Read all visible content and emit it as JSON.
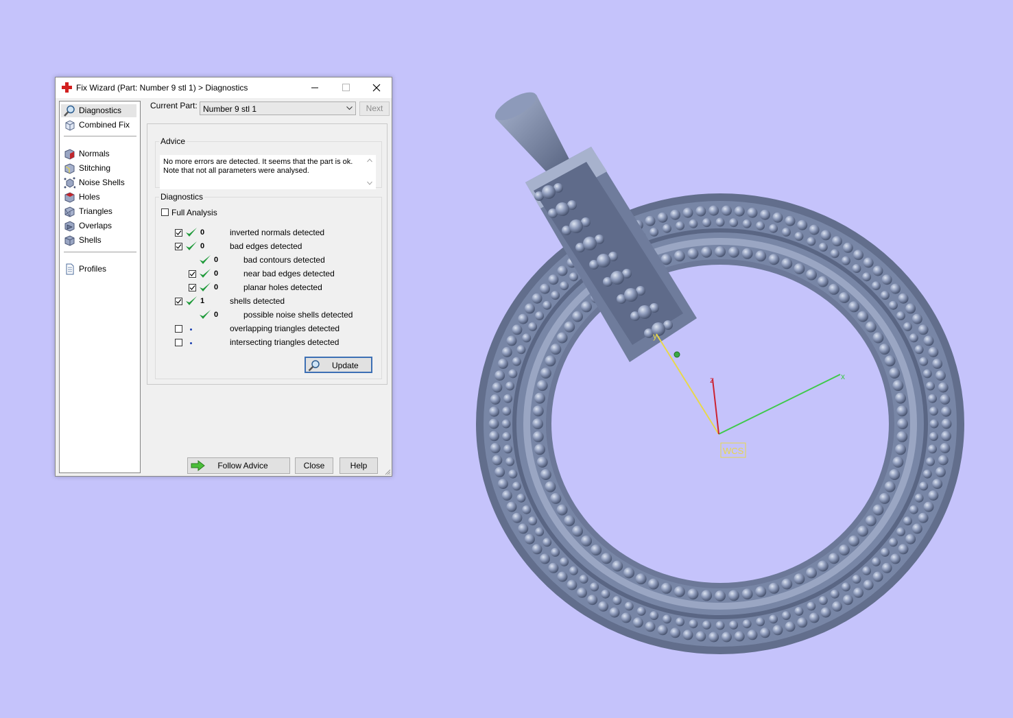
{
  "window": {
    "title": "Fix Wizard (Part: Number 9 stl 1) > Diagnostics",
    "controls": {
      "minimize": "minimize-icon",
      "maximize": "maximize-icon",
      "close": "close-icon"
    }
  },
  "sidebar": {
    "items": [
      {
        "label": "Diagnostics",
        "icon": "magnifier-icon",
        "selected": true
      },
      {
        "label": "Combined Fix",
        "icon": "cube-icon"
      },
      {
        "label": "Normals",
        "icon": "normals-cube-icon"
      },
      {
        "label": "Stitching",
        "icon": "stitching-cube-icon"
      },
      {
        "label": "Noise Shells",
        "icon": "noise-shells-icon"
      },
      {
        "label": "Holes",
        "icon": "holes-cube-icon"
      },
      {
        "label": "Triangles",
        "icon": "triangles-cube-icon"
      },
      {
        "label": "Overlaps",
        "icon": "overlaps-cube-icon"
      },
      {
        "label": "Shells",
        "icon": "shells-cube-icon"
      },
      {
        "label": "Profiles",
        "icon": "document-icon"
      }
    ]
  },
  "current_part": {
    "label": "Current Part:",
    "value": "Number 9 stl 1",
    "next_label": "Next"
  },
  "advice": {
    "legend": "Advice",
    "text": "No more errors are detected. It seems that the part is ok. Note that not all parameters were analysed."
  },
  "diagnostics": {
    "legend": "Diagnostics",
    "full_analysis_label": "Full Analysis",
    "full_analysis_checked": false,
    "rows": [
      {
        "checkbox": true,
        "checked": true,
        "status": "ok",
        "count": "0",
        "text": "inverted normals detected",
        "indent": 0
      },
      {
        "checkbox": true,
        "checked": true,
        "status": "ok",
        "count": "0",
        "text": "bad edges detected",
        "indent": 0
      },
      {
        "checkbox": false,
        "checked": false,
        "status": "ok",
        "count": "0",
        "text": "bad contours detected",
        "indent": 1
      },
      {
        "checkbox": true,
        "checked": true,
        "status": "ok",
        "count": "0",
        "text": "near bad edges detected",
        "indent": 1
      },
      {
        "checkbox": true,
        "checked": true,
        "status": "ok",
        "count": "0",
        "text": "planar holes detected",
        "indent": 1
      },
      {
        "checkbox": true,
        "checked": true,
        "status": "ok",
        "count": "1",
        "text": "shells detected",
        "indent": 0
      },
      {
        "checkbox": false,
        "checked": false,
        "status": "ok",
        "count": "0",
        "text": "possible noise shells detected",
        "indent": 1
      },
      {
        "checkbox": true,
        "checked": false,
        "status": "unknown",
        "count": "",
        "text": "overlapping triangles detected",
        "indent": 0
      },
      {
        "checkbox": true,
        "checked": false,
        "status": "unknown",
        "count": "",
        "text": "intersecting triangles detected",
        "indent": 0
      }
    ],
    "update_label": "Update"
  },
  "footer": {
    "follow_advice_label": "Follow Advice",
    "close_label": "Close",
    "help_label": "Help"
  },
  "viewport": {
    "background": "#c5c3fb",
    "model_color": "#7d8bab",
    "axis_x_label": "x",
    "axis_y_label": "y",
    "axis_z_label": "z",
    "wcs_label": "WCS"
  }
}
